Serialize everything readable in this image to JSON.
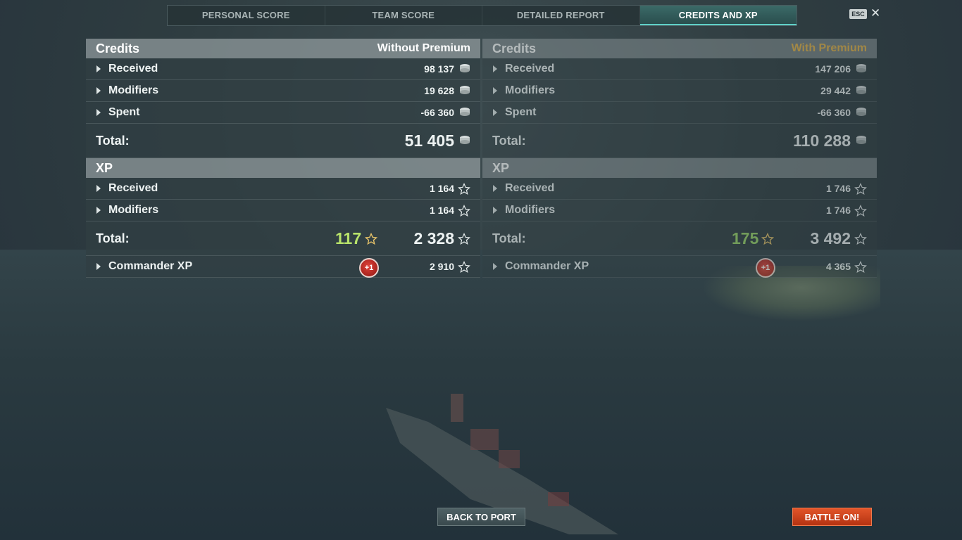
{
  "tabs": [
    {
      "label": "PERSONAL SCORE"
    },
    {
      "label": "TEAM SCORE"
    },
    {
      "label": "DETAILED REPORT"
    },
    {
      "label": "CREDITS AND XP",
      "active": true
    }
  ],
  "esc_label": "ESC",
  "close_glyph": "✕",
  "left": {
    "credits_title": "Credits",
    "subtitle": "Without Premium",
    "credits_rows": [
      {
        "label": "Received",
        "value": "98 137"
      },
      {
        "label": "Modifiers",
        "value": "19 628"
      },
      {
        "label": "Spent",
        "value": "-66 360"
      }
    ],
    "credits_total_label": "Total:",
    "credits_total": "51 405",
    "xp_title": "XP",
    "xp_rows": [
      {
        "label": "Received",
        "value": "1 164"
      },
      {
        "label": "Modifiers",
        "value": "1 164"
      }
    ],
    "xp_total_label": "Total:",
    "xp_free": "117",
    "xp_total": "2 328",
    "commander_label": "Commander XP",
    "commander_badge": "+1",
    "commander_value": "2 910"
  },
  "right": {
    "credits_title": "Credits",
    "subtitle": "With Premium",
    "credits_rows": [
      {
        "label": "Received",
        "value": "147 206"
      },
      {
        "label": "Modifiers",
        "value": "29 442"
      },
      {
        "label": "Spent",
        "value": "-66 360"
      }
    ],
    "credits_total_label": "Total:",
    "credits_total": "110 288",
    "xp_title": "XP",
    "xp_rows": [
      {
        "label": "Received",
        "value": "1 746"
      },
      {
        "label": "Modifiers",
        "value": "1 746"
      }
    ],
    "xp_total_label": "Total:",
    "xp_free": "175",
    "xp_total": "3 492",
    "commander_label": "Commander XP",
    "commander_badge": "+1",
    "commander_value": "4 365"
  },
  "buttons": {
    "back_to_port": "BACK TO PORT",
    "battle_on": "BATTLE ON!"
  },
  "colors": {
    "accent_tab": "#5fd1c8",
    "premium_gold": "#e8b64a",
    "free_xp_green": "#b8e36a",
    "battle_orange": "#d8441c"
  }
}
